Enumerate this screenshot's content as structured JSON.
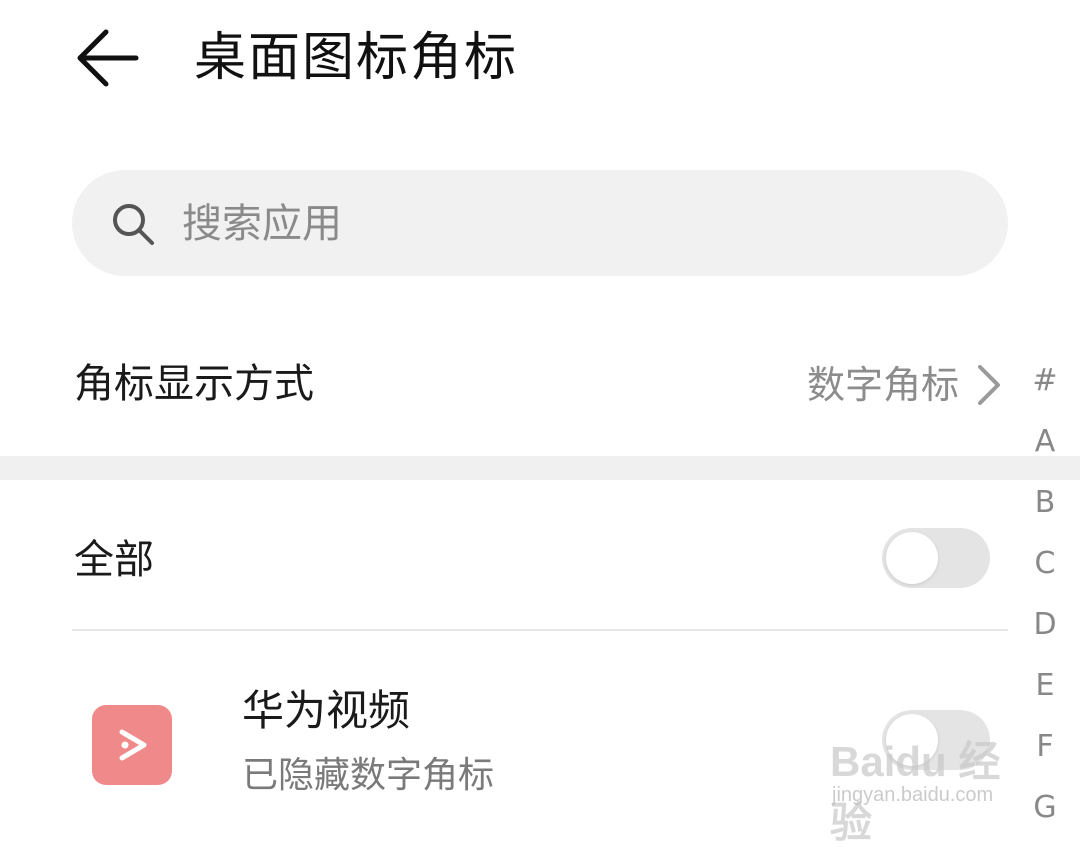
{
  "header": {
    "back_icon": "back-arrow-icon",
    "title": "桌面图标角标"
  },
  "search": {
    "icon": "search-icon",
    "placeholder": "搜索应用",
    "value": ""
  },
  "badge_mode": {
    "label": "角标显示方式",
    "value": "数字角标",
    "icon": "chevron-right-icon"
  },
  "all": {
    "label": "全部",
    "enabled": false
  },
  "apps": [
    {
      "name": "华为视频",
      "status": "已隐藏数字角标",
      "icon": "play-icon",
      "icon_color": "#f08a8a",
      "enabled": false
    }
  ],
  "index_bar": [
    "#",
    "A",
    "B",
    "C",
    "D",
    "E",
    "F",
    "G"
  ],
  "watermark": {
    "brand": "Baidu 经验",
    "url": "jingyan.baidu.com"
  },
  "colors": {
    "background": "#ffffff",
    "search_bg": "#f1f1f1",
    "toggle_off": "#e4e4e4",
    "secondary_text": "#8c8c8c"
  }
}
